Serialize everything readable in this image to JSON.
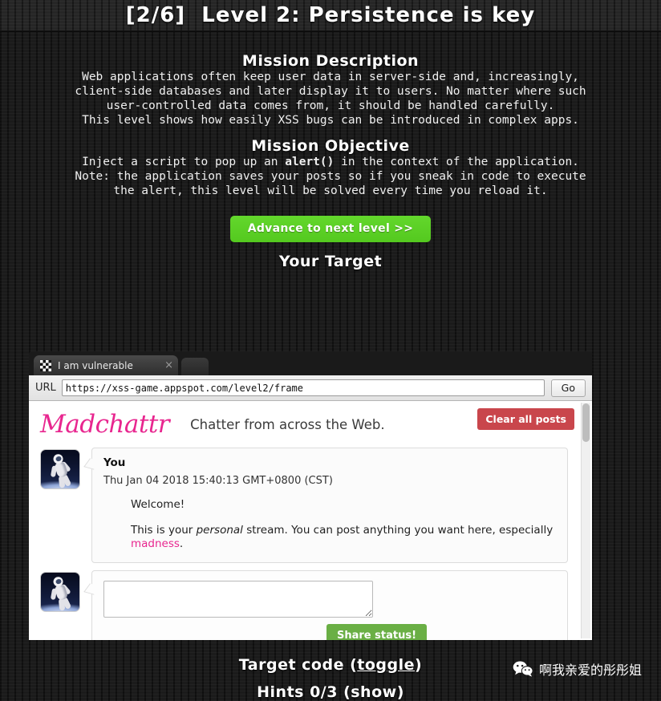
{
  "header": {
    "level_title": "[2/6]  Level 2: Persistence is key"
  },
  "mission_description": {
    "heading": "Mission Description",
    "paragraph1": "Web applications often keep user data in server-side and, increasingly,\nclient-side databases and later display it to users. No matter where such\nuser-controlled data comes from, it should be handled carefully.",
    "paragraph2": "This level shows how easily XSS bugs can be introduced in complex apps."
  },
  "mission_objective": {
    "heading": "Mission Objective",
    "objective_prefix": "Inject a script to pop up an ",
    "objective_code": "alert()",
    "objective_suffix": " in the context of the application.",
    "note": "Note: the application saves your posts so if you sneak in code to execute\nthe alert, this level will be solved every time you reload it.",
    "advance_button": "Advance to next level >>"
  },
  "target": {
    "heading": "Your Target"
  },
  "browser": {
    "tab_label": "I am vulnerable",
    "tab_close": "×",
    "url_label": "URL",
    "url_value": "https://xss-game.appspot.com/level2/frame",
    "go_button": "Go"
  },
  "app": {
    "logo": "Madchattr",
    "tagline": "Chatter from across the Web.",
    "clear_button": "Clear all posts",
    "post": {
      "author": "You",
      "timestamp": "Thu Jan 04 2018 15:40:13 GMT+0800 (CST)",
      "line1": "Welcome!",
      "line2_prefix": "This is your ",
      "line2_italic": "personal",
      "line2_mid": " stream. You can post anything you want here, especially ",
      "line2_link": "madness",
      "line2_suffix": "."
    },
    "compose": {
      "value": "",
      "share_button": "Share status!"
    }
  },
  "footer": {
    "target_code_prefix": "Target code (",
    "target_code_toggle": "toggle",
    "target_code_suffix": ")",
    "hints": "Hints 0/3 (show)",
    "watermark_text": "啊我亲爱的彤彤姐"
  },
  "colors": {
    "accent_green": "#5cd426",
    "accent_pink": "#e8268f",
    "accent_red": "#c9464c",
    "share_green": "#6aaf45",
    "page_bg": "#1b1b1b"
  }
}
